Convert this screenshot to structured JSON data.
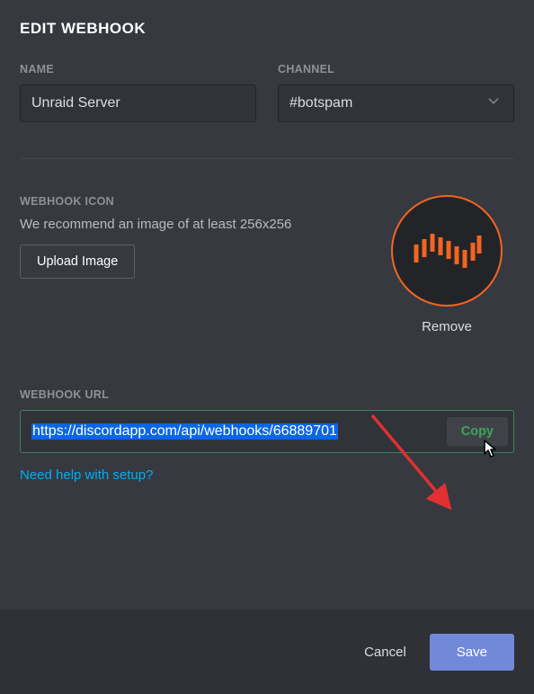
{
  "title": "EDIT WEBHOOK",
  "name": {
    "label": "NAME",
    "value": "Unraid Server"
  },
  "channel": {
    "label": "CHANNEL",
    "value": "#botspam"
  },
  "icon": {
    "label": "WEBHOOK ICON",
    "recommend": "We recommend an image of at least 256x256",
    "upload_label": "Upload Image",
    "remove_label": "Remove"
  },
  "url": {
    "label": "WEBHOOK URL",
    "value": "https://discordapp.com/api/webhooks/66889701",
    "copy_label": "Copy",
    "help_label": "Need help with setup?"
  },
  "footer": {
    "cancel_label": "Cancel",
    "save_label": "Save"
  }
}
